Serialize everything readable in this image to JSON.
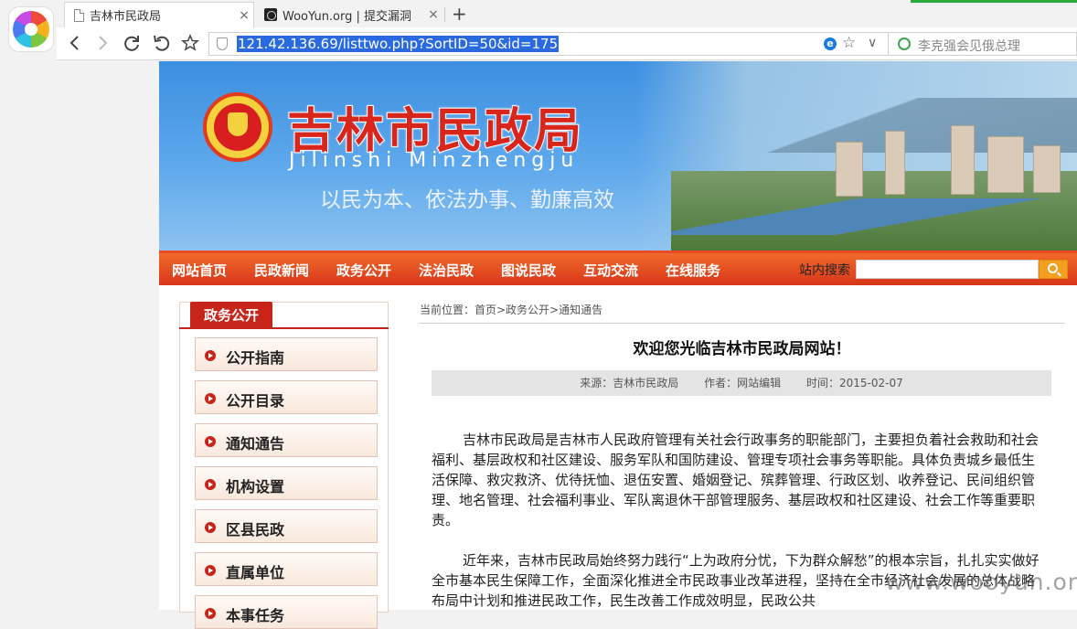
{
  "browser": {
    "tabs": [
      {
        "label": "吉林市民政局",
        "active": true
      },
      {
        "label": "WooYun.org | 提交漏洞",
        "active": false
      }
    ],
    "new_tab": "+",
    "close_glyph": "×",
    "url": "121.42.136.69/listtwo.php?SortID=50&id=175",
    "search_placeholder": "李克强会见俄总理",
    "icons": [
      "back-icon",
      "forward-icon",
      "refresh-icon",
      "undo-icon",
      "star-icon",
      "shield-icon",
      "ie-icon",
      "dropdown-icon",
      "search-icon"
    ]
  },
  "banner": {
    "title": "吉林市民政局",
    "pinyin": "Jilinshi Minzhengju",
    "slogan": "以民为本、依法办事、勤廉高效"
  },
  "menu": {
    "items": [
      "网站首页",
      "民政新闻",
      "政务公开",
      "法治民政",
      "图说民政",
      "互动交流",
      "在线服务"
    ],
    "search_label": "站内搜索"
  },
  "sidebar": {
    "title": "政务公开",
    "items": [
      "公开指南",
      "公开目录",
      "通知通告",
      "机构设置",
      "区县民政",
      "直属单位",
      "本事任务"
    ]
  },
  "article": {
    "breadcrumb": "当前位置：首页>政务公开>通知通告",
    "title": "欢迎您光临吉林市民政局网站！",
    "source": "来源：吉林市民政局",
    "author": "作者：网站编辑",
    "time": "时间：2015-02-07",
    "paragraphs": [
      "吉林市民政局是吉林市人民政府管理有关社会行政事务的职能部门，主要担负着社会救助和社会福利、基层政权和社区建设、服务军队和国防建设、管理专项社会事务等职能。具体负责城乡最低生活保障、救灾救济、优待抚恤、退伍安置、婚姻登记、殡葬管理、行政区划、收养登记、民间组织管理、地名管理、社会福利事业、军队离退休干部管理服务、基层政权和社区建设、社会工作等重要职责。",
      "近年来，吉林市民政局始终努力践行“上为政府分忧，下为群众解愁”的根本宗旨，扎扎实实做好全市基本民生保障工作，全面深化推进全市民政事业改革进程，坚持在全市经济社会发展的总体战略布局中计划和推进民政工作，民生改善工作成效明显，民政公共"
    ]
  },
  "watermark": "www.wooyun.org"
}
